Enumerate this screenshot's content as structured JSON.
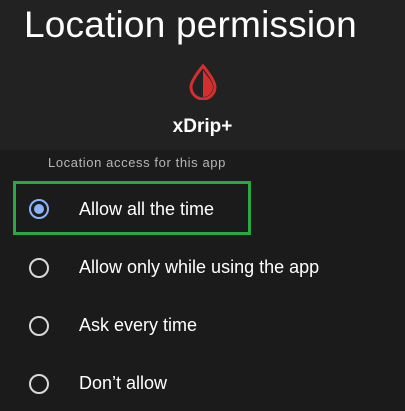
{
  "page": {
    "title": "Location permission"
  },
  "app": {
    "name": "xDrip+",
    "icon": "blood-drop-icon",
    "icon_color": "#d32f2f"
  },
  "section": {
    "label": "Location access for this app"
  },
  "options": [
    {
      "label": "Allow all the time",
      "selected": true
    },
    {
      "label": "Allow only while using the app",
      "selected": false
    },
    {
      "label": "Ask every time",
      "selected": false
    },
    {
      "label": "Don’t allow",
      "selected": false
    }
  ],
  "colors": {
    "background": "#1b1b1b",
    "header_background": "#222222",
    "radio_selected": "#8ab4f8",
    "highlight": "#27a844"
  }
}
